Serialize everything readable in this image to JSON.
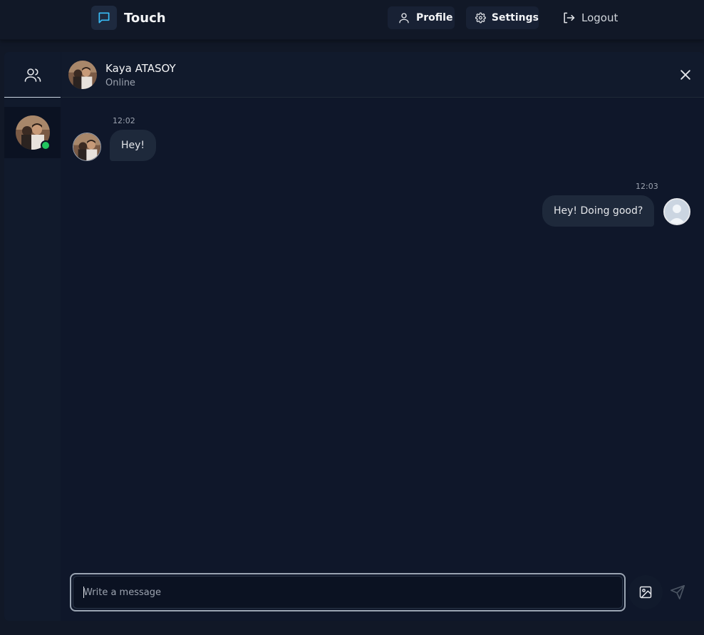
{
  "app": {
    "name": "Touch",
    "accent": "#38bdf8"
  },
  "nav": {
    "profile_label": "Profile",
    "settings_label": "Settings",
    "logout_label": "Logout"
  },
  "sidebar": {
    "tab_icon": "users-icon",
    "contacts": [
      {
        "name": "Kaya ATASOY",
        "status": "online",
        "status_color": "#22c55e"
      }
    ]
  },
  "chat": {
    "contact_name": "Kaya ATASOY",
    "contact_status": "Online",
    "messages": [
      {
        "direction": "incoming",
        "time": "12:02",
        "text": "Hey!"
      },
      {
        "direction": "outgoing",
        "time": "12:03",
        "text": "Hey! Doing good?"
      }
    ]
  },
  "composer": {
    "placeholder": "Write a message",
    "value": ""
  }
}
